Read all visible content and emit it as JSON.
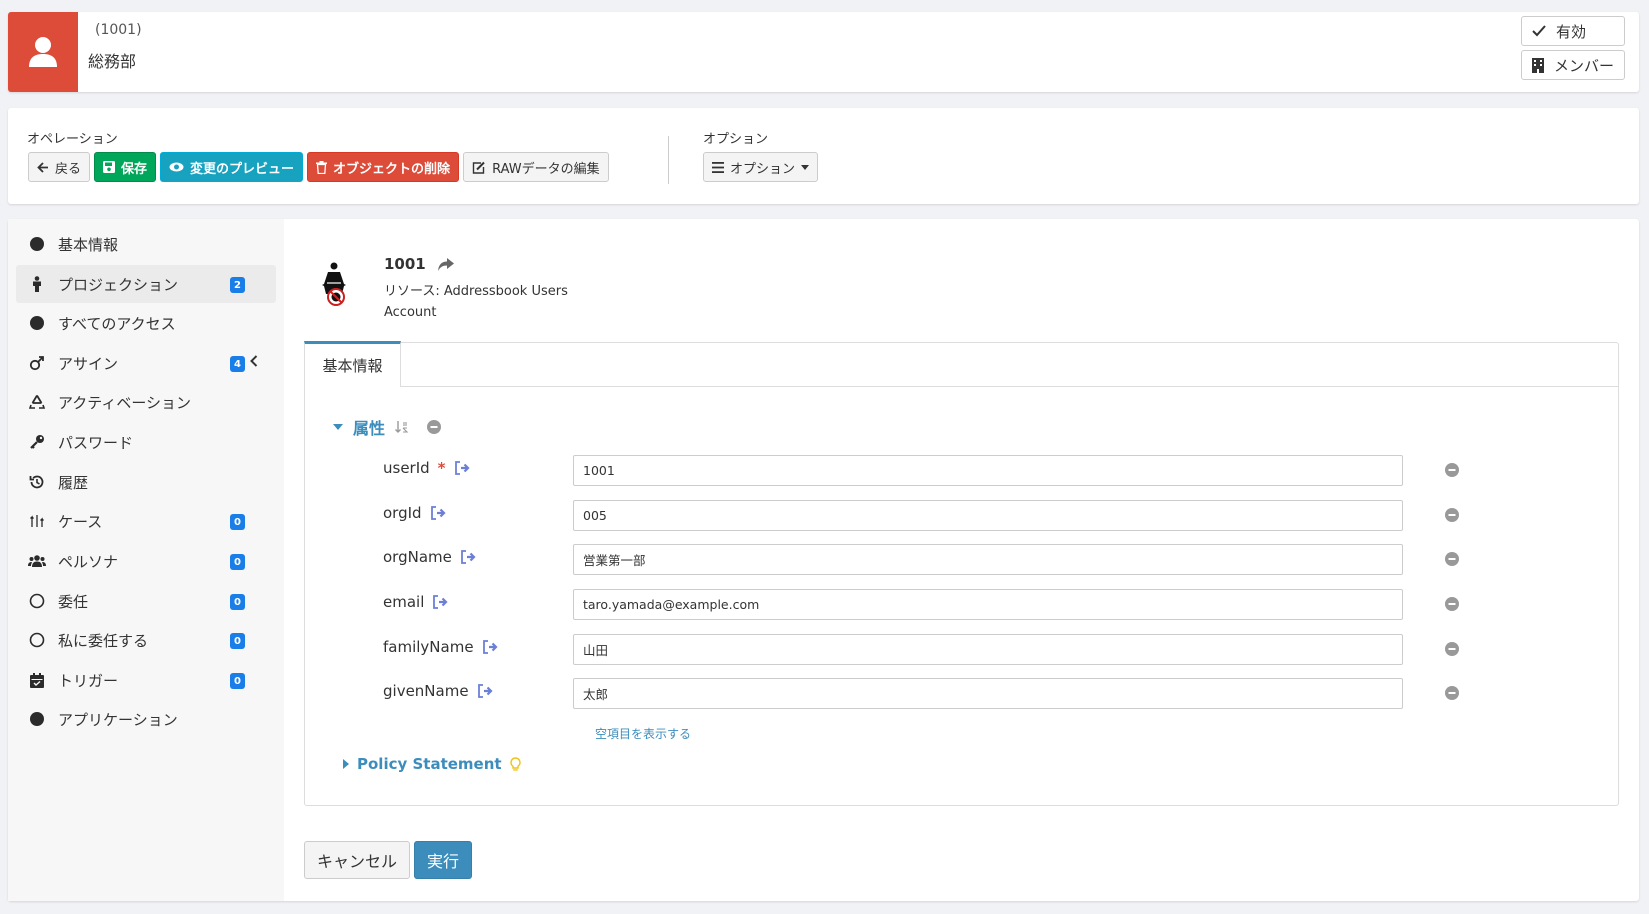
{
  "header": {
    "id": "(1001)",
    "name": "総務部",
    "enabled_label": "有効",
    "members_label": "メンバー"
  },
  "operations": {
    "label": "オペレーション",
    "back": "戻る",
    "save": "保存",
    "preview": "変更のプレビュー",
    "delete": "オブジェクトの削除",
    "raw_edit": "RAWデータの編集",
    "options_label": "オプション",
    "options_button": "オプション"
  },
  "sidebar": {
    "items": [
      {
        "label": "基本情報",
        "icon": "circle-icon"
      },
      {
        "label": "プロジェクション",
        "icon": "person-icon",
        "badge": "2"
      },
      {
        "label": "すべてのアクセス",
        "icon": "circle-icon"
      },
      {
        "label": "アサイン",
        "icon": "mars-icon",
        "badge": "4"
      },
      {
        "label": "アクティベーション",
        "icon": "recycle-icon"
      },
      {
        "label": "パスワード",
        "icon": "key-icon"
      },
      {
        "label": "履歴",
        "icon": "history-icon"
      },
      {
        "label": "ケース",
        "icon": "case-icon",
        "badge": "0"
      },
      {
        "label": "ペルソナ",
        "icon": "users-icon",
        "badge": "0"
      },
      {
        "label": "委任",
        "icon": "circle-outline-icon",
        "badge": "0"
      },
      {
        "label": "私に委任する",
        "icon": "circle-outline-icon",
        "badge": "0"
      },
      {
        "label": "トリガー",
        "icon": "calendar-icon",
        "badge": "0"
      },
      {
        "label": "アプリケーション",
        "icon": "circle-icon"
      }
    ]
  },
  "object": {
    "name": "1001",
    "resource": "リソース: Addressbook Users",
    "type": "Account"
  },
  "tab": {
    "label": "基本情報"
  },
  "attributes": {
    "title": "属性",
    "fields": [
      {
        "name": "userId",
        "value": "1001",
        "required": true
      },
      {
        "name": "orgId",
        "value": "005"
      },
      {
        "name": "orgName",
        "value": "営業第一部"
      },
      {
        "name": "email",
        "value": "taro.yamada@example.com"
      },
      {
        "name": "familyName",
        "value": "山田"
      },
      {
        "name": "givenName",
        "value": "太郎"
      }
    ],
    "show_empty": "空項目を表示する"
  },
  "policy": {
    "title": "Policy Statement"
  },
  "footer": {
    "cancel": "キャンセル",
    "execute": "実行"
  },
  "colors": {
    "avatar": "#dd4b39",
    "save": "#00a65a",
    "preview": "#17a2c0",
    "delete": "#dd4b39",
    "link": "#3c8dbc",
    "badge": "#1a7ee8"
  }
}
